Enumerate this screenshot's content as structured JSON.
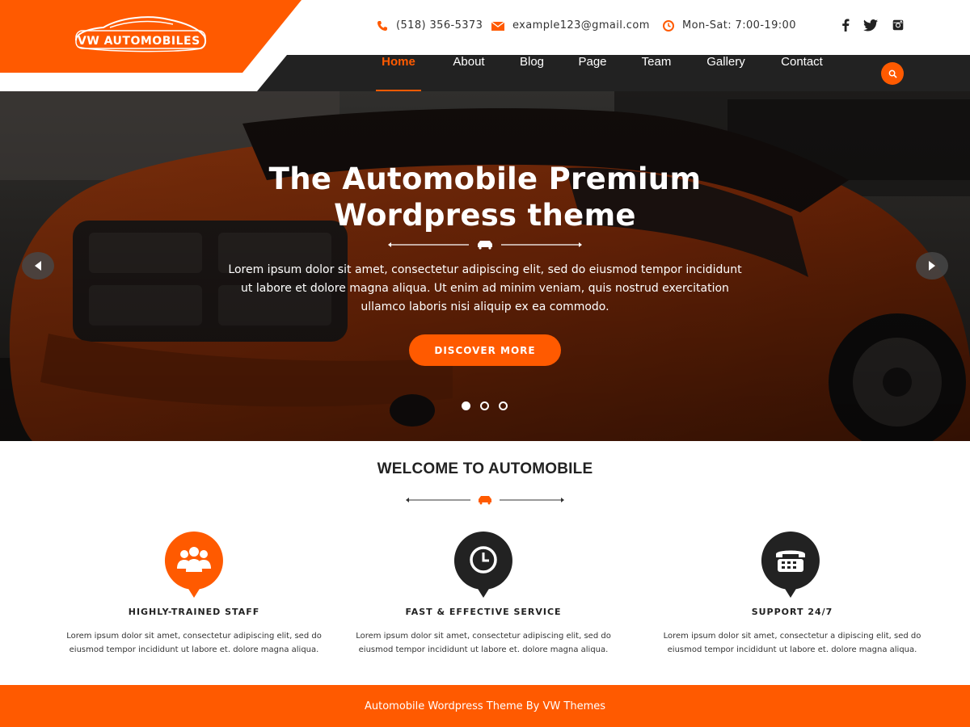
{
  "brand": {
    "name": "VW AUTOMOBILES",
    "accent": "#ff5a00",
    "dark": "#222222"
  },
  "contact": {
    "phone": "(518) 356-5373",
    "email": "example123@gmail.com",
    "hours": "Mon-Sat: 7:00-19:00"
  },
  "social": [
    "facebook-icon",
    "twitter-icon",
    "instagram-icon"
  ],
  "nav": {
    "items": [
      "Home",
      "About",
      "Blog",
      "Page",
      "Team",
      "Gallery",
      "Contact"
    ],
    "active": "Home"
  },
  "hero": {
    "title_line1": "The Automobile Premium",
    "title_line2": "Wordpress theme",
    "text": "Lorem ipsum dolor sit amet, consectetur adipiscing elit, sed do eiusmod tempor incididunt ut labore et dolore magna aliqua. Ut enim ad minim veniam, quis nostrud exercitation ullamco laboris nisi aliquip ex ea commodo.",
    "button": "DISCOVER MORE",
    "slide_count": 3,
    "active_slide": 1
  },
  "welcome": {
    "title": "WELCOME TO AUTOMOBILE"
  },
  "features": [
    {
      "icon": "users-icon",
      "color": "#ff5a00",
      "title": "HIGHLY-TRAINED STAFF",
      "text": "Lorem ipsum dolor sit amet, consectetur adipiscing elit, sed do eiusmod tempor incididunt ut labore et. dolore magna aliqua."
    },
    {
      "icon": "clock-icon",
      "color": "#222222",
      "title": "FAST & EFFECTIVE SERVICE",
      "text": "Lorem ipsum dolor sit amet, consectetur adipiscing elit, sed do eiusmod tempor incididunt ut labore et. dolore magna aliqua."
    },
    {
      "icon": "telephone-icon",
      "color": "#222222",
      "title": "SUPPORT 24/7",
      "text": "Lorem ipsum dolor sit amet, consectetur a dipiscing elit, sed do eiusmod tempor incididunt ut labore et. dolore magna aliqua."
    }
  ],
  "footer": {
    "text": "Automobile Wordpress Theme By VW Themes"
  }
}
